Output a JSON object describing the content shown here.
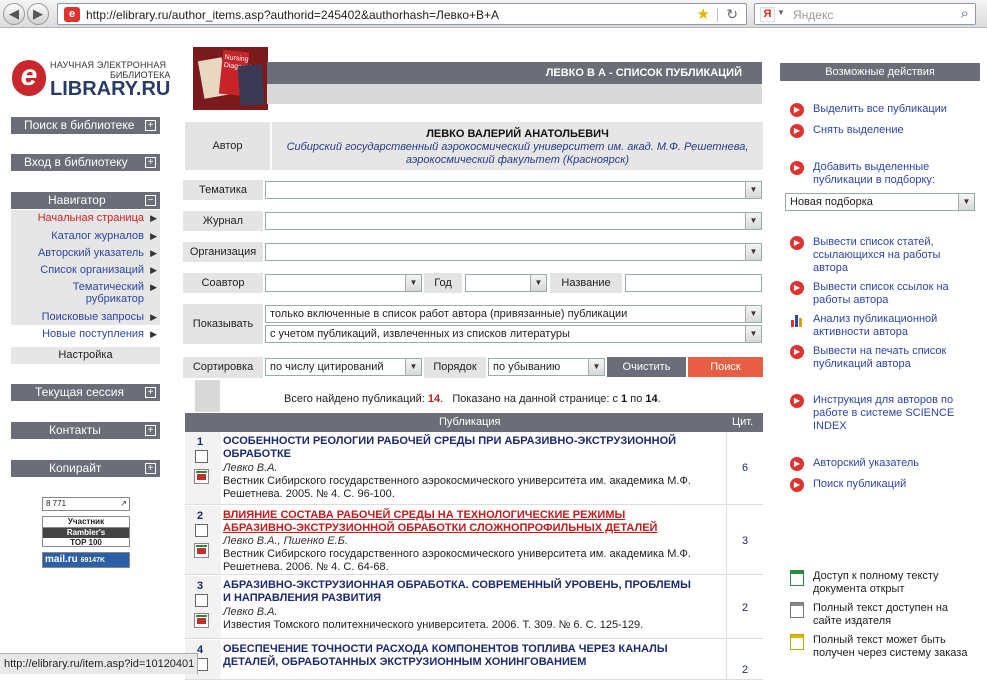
{
  "browser": {
    "url": "http://elibrary.ru/author_items.asp?authorid=245402&authorhash=Левко+В+А",
    "search_placeholder": "Яндекс",
    "status_url": "http://elibrary.ru/item.asp?id=10120401"
  },
  "logo": {
    "line1": "НАУЧНАЯ ЭЛЕКТРОННАЯ",
    "line2": "БИБЛИОТЕКА",
    "brand": "LIBRARY.RU",
    "letter": "e"
  },
  "left": {
    "search": "Поиск в библиотеке",
    "login": "Вход в библиотеку",
    "navigator": "Навигатор",
    "nav_items": [
      "Начальная страница",
      "Каталог журналов",
      "Авторский указатель",
      "Список организаций",
      "Тематический рубрикатор",
      "Поисковые запросы",
      "Новые поступления"
    ],
    "settings": "Настройка",
    "session": "Текущая сессия",
    "contacts": "Контакты",
    "copyright": "Копирайт",
    "counter_rambler": {
      "l1": "Участник",
      "l2": "Rambler's",
      "l3": "TOP 100"
    },
    "counter_mail": {
      "brand": "mail.ru",
      "num": "69147K"
    },
    "counter_top": "8 771"
  },
  "page": {
    "title": "ЛЕВКО В А - СПИСОК ПУБЛИКАЦИЙ",
    "author_label": "Автор",
    "author_name": "ЛЕВКО ВАЛЕРИЙ АНАТОЛЬЕВИЧ",
    "author_affil": "Сибирский государственный аэрокосмический университет им. акад. М.Ф. Решетнева, аэрокосмический факультет (Красноярск)"
  },
  "filters": {
    "topic": "Тематика",
    "journal": "Журнал",
    "org": "Организация",
    "coauthor": "Соавтор",
    "year": "Год",
    "name": "Название",
    "show": "Показывать",
    "show_opt1": "только включенные в список работ автора (привязанные) публикации",
    "show_opt2": "с учетом публикаций, извлеченных из списков литературы",
    "sort": "Сортировка",
    "sort_value": "по числу цитирований",
    "order": "Порядок",
    "order_value": "по убыванию",
    "clear": "Очистить",
    "search": "Поиск"
  },
  "summary": {
    "found_label": "Всего найдено публикаций:",
    "found": "14",
    "shown_label": "Показано на данной странице: с",
    "from": "1",
    "to_label": "по",
    "to": "14"
  },
  "table": {
    "col_pub": "Публикация",
    "col_cit": "Цит.",
    "rows": [
      {
        "no": "1",
        "title": "ОСОБЕННОСТИ РЕОЛОГИИ РАБОЧЕЙ СРЕДЫ ПРИ АБРАЗИВНО-ЭКСТРУЗИОННОЙ ОБРАБОТКЕ",
        "authors": "Левко В.А.",
        "source": "Вестник Сибирского государственного аэрокосмического университета им. академика М.Ф. Решетнева. 2005. № 4. С. 96-100.",
        "cit": "6"
      },
      {
        "no": "2",
        "title": "ВЛИЯНИЕ СОСТАВА РАБОЧЕЙ СРЕДЫ НА ТЕХНОЛОГИЧЕСКИЕ РЕЖИМЫ АБРАЗИВНО-ЭКСТРУЗИОННОЙ ОБРАБОТКИ СЛОЖНОПРОФИЛЬНЫХ ДЕТАЛЕЙ",
        "authors": "Левко В.А., Пшенко Е.Б.",
        "source": "Вестник Сибирского государственного аэрокосмического университета им. академика М.Ф. Решетнева. 2006. № 4. С. 64-68.",
        "cit": "3"
      },
      {
        "no": "3",
        "title": "АБРАЗИВНО-ЭКСТРУЗИОННАЯ ОБРАБОТКА. СОВРЕМЕННЫЙ УРОВЕНЬ, ПРОБЛЕМЫ И НАПРАВЛЕНИЯ РАЗВИТИЯ",
        "authors": "Левко В.А.",
        "source": "Известия Томского политехнического университета. 2006. Т. 309. № 6. С. 125-129.",
        "cit": "2"
      },
      {
        "no": "4",
        "title": "ОБЕСПЕЧЕНИЕ ТОЧНОСТИ РАСХОДА КОМПОНЕНТОВ ТОПЛИВА ЧЕРЕЗ КАНАЛЫ ДЕТАЛЕЙ, ОБРАБОТАННЫХ ЭКСТРУЗИОННЫМ ХОНИНГОВАНИЕМ",
        "authors": "",
        "source": "",
        "cit": "2"
      }
    ]
  },
  "right": {
    "header": "Возможные действия",
    "select_all": "Выделить все публикации",
    "deselect": "Снять выделение",
    "add_to": "Добавить выделенные публикации в подборку:",
    "new_collection": "Новая подборка",
    "cited_list": "Вывести список статей, ссылающихся на работы автора",
    "refs_list": "Вывести список ссылок на работы автора",
    "analysis": "Анализ публикационной активности автора",
    "print_list": "Вывести на печать список публикаций автора",
    "instruction": "Инструкция для авторов по работе в системе SCIENCE INDEX",
    "author_index": "Авторский указатель",
    "pub_search": "Поиск публикаций",
    "legend_open": "Доступ к полному тексту документа открыт",
    "legend_publisher": "Полный текст доступен на сайте издателя",
    "legend_order": "Полный текст может быть получен через систему заказа"
  }
}
